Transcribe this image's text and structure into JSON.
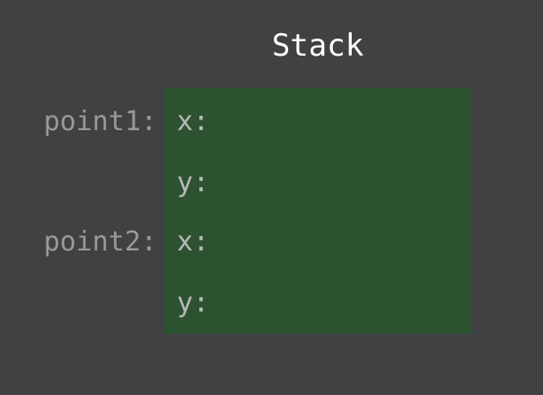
{
  "title": "Stack",
  "colors": {
    "background": "#414042",
    "stack_fill": "#2d5230",
    "title_text": "#ffffff",
    "field_text": "#b8b9b7",
    "label_text": "#999a98"
  },
  "variables": [
    {
      "label": "point1:",
      "fields": [
        "x:",
        "y:"
      ]
    },
    {
      "label": "point2:",
      "fields": [
        "x:",
        "y:"
      ]
    }
  ]
}
